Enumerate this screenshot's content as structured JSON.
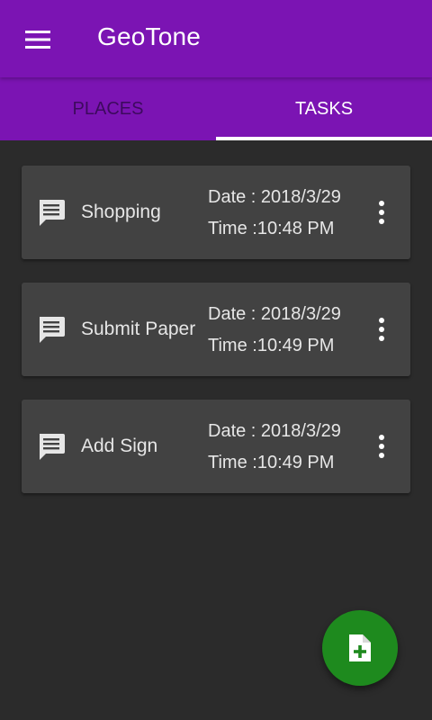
{
  "app": {
    "title": "GeoTone",
    "accent_color": "#7b14b3",
    "fab_color": "#1e8a1e"
  },
  "appbar": {
    "menu_icon": "menu-icon"
  },
  "tabs": [
    {
      "label": "PLACES",
      "active": false
    },
    {
      "label": "TASKS",
      "active": true
    }
  ],
  "tasks": [
    {
      "name": "Shopping",
      "date_label": "Date :",
      "date": "2018/3/29",
      "time_label": "Time :",
      "time": "10:48 PM",
      "icon": "chat-icon"
    },
    {
      "name": "Submit Paper",
      "date_label": "Date :",
      "date": "2018/3/29",
      "time_label": "Time :",
      "time": "10:49 PM",
      "icon": "chat-icon"
    },
    {
      "name": "Add Sign",
      "date_label": "Date :",
      "date": "2018/3/29",
      "time_label": "Time :",
      "time": "10:49 PM",
      "icon": "chat-icon"
    }
  ],
  "fab": {
    "icon": "add-file-icon"
  }
}
